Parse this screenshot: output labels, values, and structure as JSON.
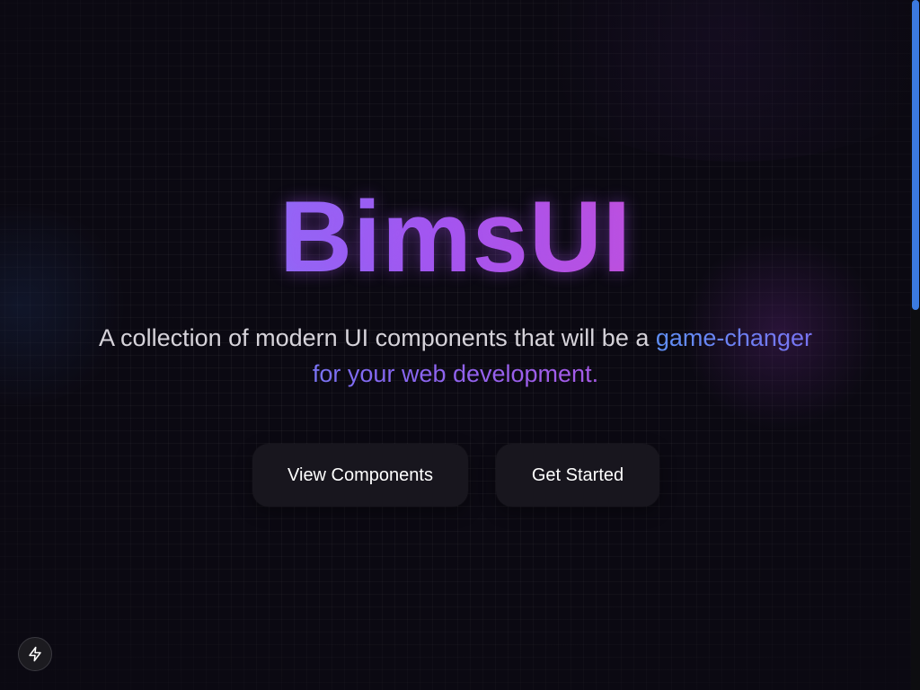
{
  "hero": {
    "title": "BimsUI",
    "subtitle_prefix": "A collection of modern UI components that will be a ",
    "subtitle_highlight": "game-changer for your web development."
  },
  "actions": {
    "view_components_label": "View Components",
    "get_started_label": "Get Started"
  },
  "badge": {
    "icon": "bolt-icon"
  },
  "colors": {
    "background": "#0b0912",
    "title_gradient_start": "#8c6cf6",
    "title_gradient_end": "#c24fd8",
    "highlight_gradient_start": "#5f8ff5",
    "highlight_gradient_end": "#a75ae8",
    "button_background": "#18161e",
    "scrollbar_thumb": "#3b7ae0"
  },
  "scroll": {
    "position_fraction": 0
  }
}
